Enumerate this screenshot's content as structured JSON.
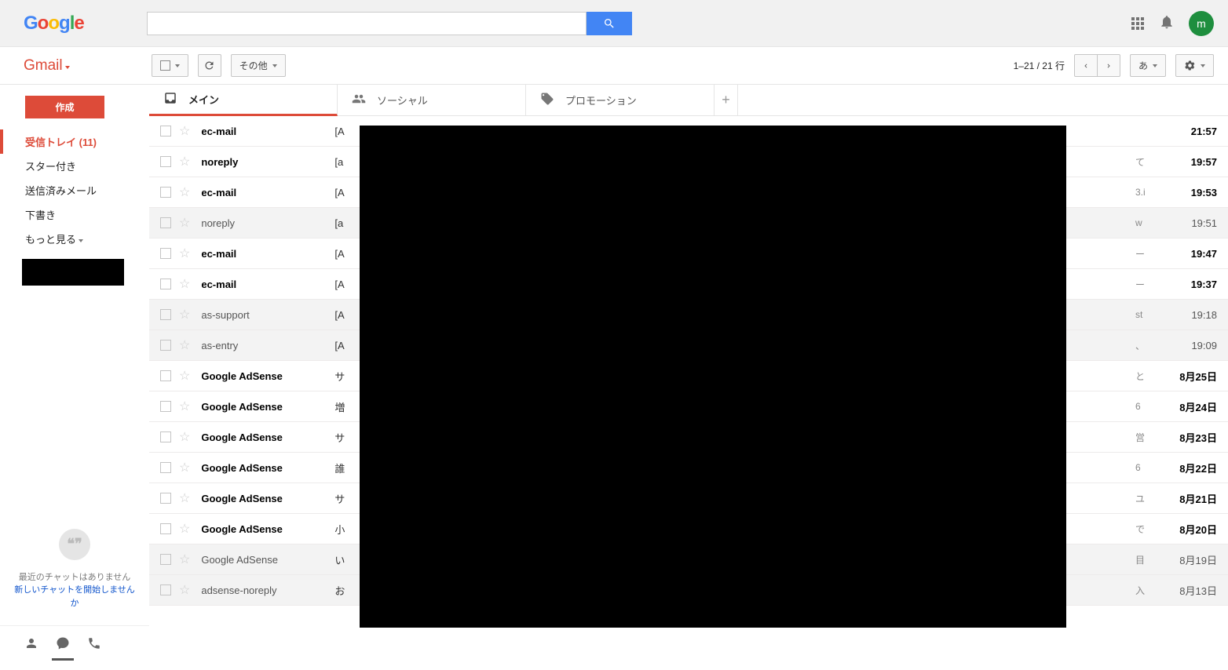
{
  "header": {
    "logo_letters": [
      "G",
      "o",
      "o",
      "g",
      "l",
      "e"
    ],
    "avatar_letter": "m"
  },
  "brand": "Gmail",
  "toolbar": {
    "other_label": "その他",
    "pagination": "1–21 / 21 行",
    "lang_label": "あ"
  },
  "sidebar": {
    "compose": "作成",
    "items": [
      {
        "label": "受信トレイ (11)",
        "active": true
      },
      {
        "label": "スター付き",
        "active": false
      },
      {
        "label": "送信済みメール",
        "active": false
      },
      {
        "label": "下書き",
        "active": false
      },
      {
        "label": "もっと見る",
        "active": false,
        "caret": true
      }
    ],
    "hangouts_text": "最近のチャットはありません",
    "hangouts_link": "新しいチャットを開始しませんか"
  },
  "tabs": [
    {
      "label": "メイン",
      "icon": "inbox",
      "active": true
    },
    {
      "label": "ソーシャル",
      "icon": "people",
      "active": false
    },
    {
      "label": "プロモーション",
      "icon": "tag",
      "active": false
    }
  ],
  "emails": [
    {
      "sender": "ec-mail",
      "subject_prefix": "[A",
      "tail": "",
      "time": "21:57",
      "unread": true
    },
    {
      "sender": "noreply",
      "subject_prefix": "[a",
      "tail": "て",
      "time": "19:57",
      "unread": true
    },
    {
      "sender": "ec-mail",
      "subject_prefix": "[A",
      "tail": "3.i",
      "time": "19:53",
      "unread": true
    },
    {
      "sender": "noreply",
      "subject_prefix": "[a",
      "tail": "w",
      "time": "19:51",
      "unread": false
    },
    {
      "sender": "ec-mail",
      "subject_prefix": "[A",
      "tail": "ー",
      "time": "19:47",
      "unread": true
    },
    {
      "sender": "ec-mail",
      "subject_prefix": "[A",
      "tail": "ー",
      "time": "19:37",
      "unread": true
    },
    {
      "sender": "as-support",
      "subject_prefix": "[A",
      "tail": "st",
      "time": "19:18",
      "unread": false
    },
    {
      "sender": "as-entry",
      "subject_prefix": "[A",
      "tail": "、",
      "time": "19:09",
      "unread": false
    },
    {
      "sender": "Google AdSense",
      "subject_prefix": "サ",
      "tail": "と",
      "time": "8月25日",
      "unread": true
    },
    {
      "sender": "Google AdSense",
      "subject_prefix": "増",
      "tail": "6",
      "time": "8月24日",
      "unread": true
    },
    {
      "sender": "Google AdSense",
      "subject_prefix": "サ",
      "tail": "営",
      "time": "8月23日",
      "unread": true
    },
    {
      "sender": "Google AdSense",
      "subject_prefix": "誰",
      "tail": "6",
      "time": "8月22日",
      "unread": true
    },
    {
      "sender": "Google AdSense",
      "subject_prefix": "サ",
      "tail": "ユ",
      "time": "8月21日",
      "unread": true
    },
    {
      "sender": "Google AdSense",
      "subject_prefix": "小",
      "tail": "で",
      "time": "8月20日",
      "unread": true
    },
    {
      "sender": "Google AdSense",
      "subject_prefix": "い",
      "tail": "目",
      "time": "8月19日",
      "unread": false
    },
    {
      "sender": "adsense-noreply",
      "subject_prefix": "お",
      "tail": "入",
      "time": "8月13日",
      "unread": false
    }
  ]
}
